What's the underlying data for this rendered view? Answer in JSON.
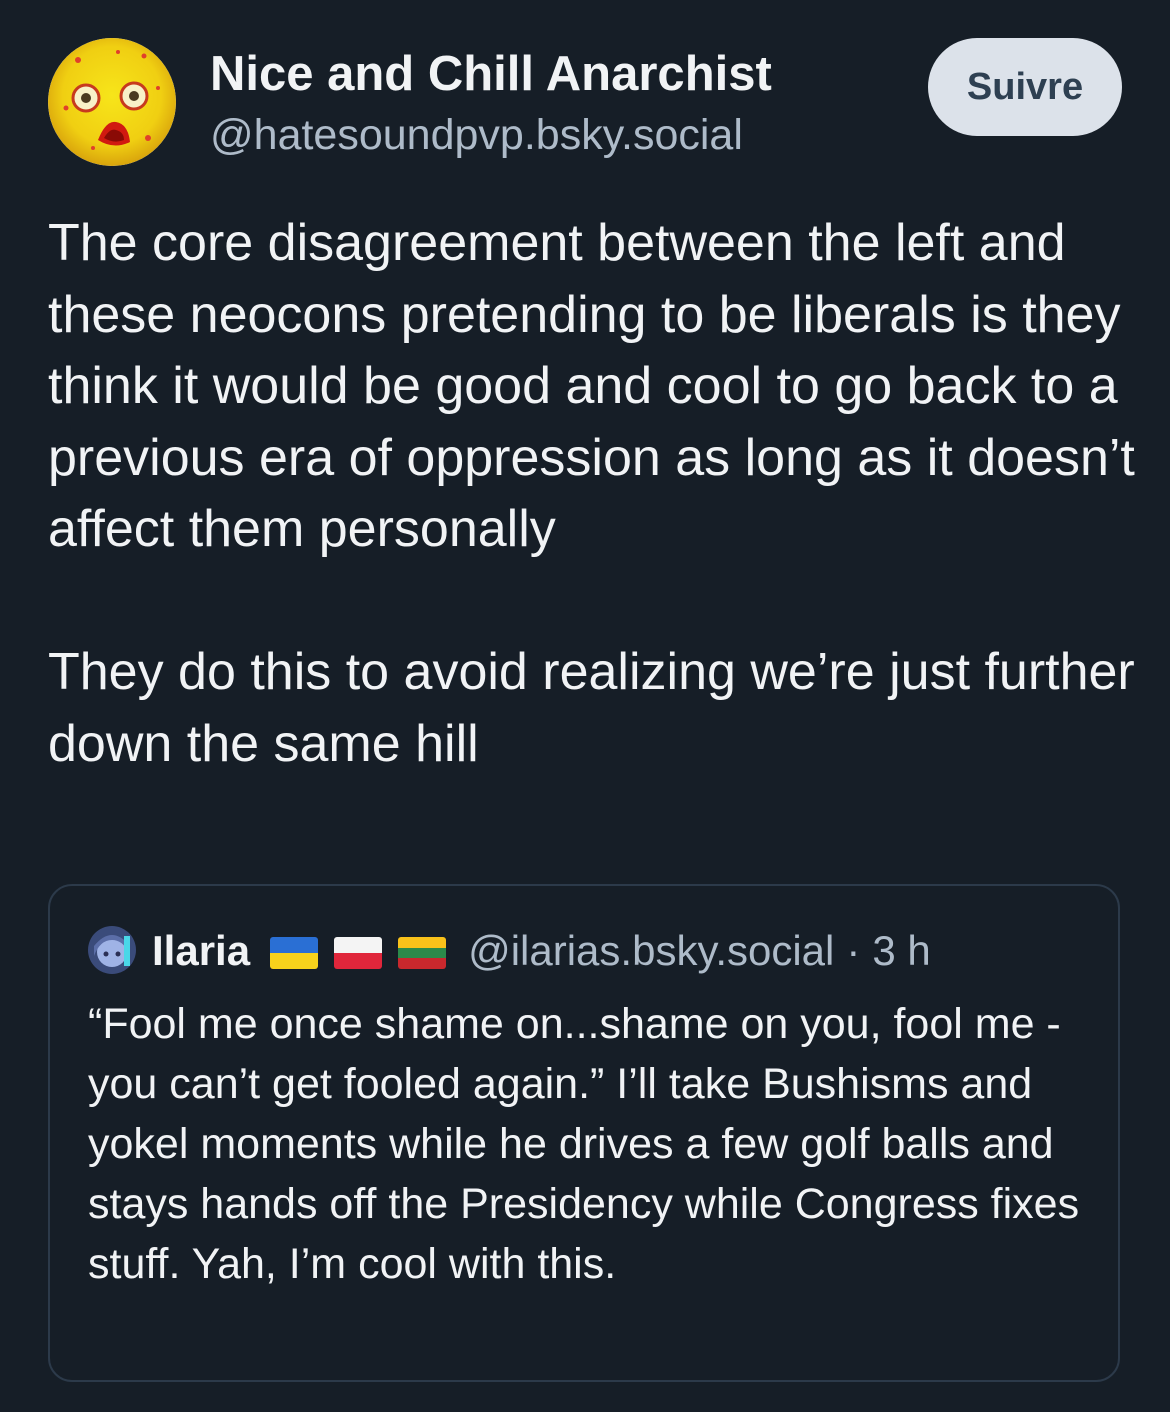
{
  "post": {
    "author": {
      "name": "Nice and Chill Anarchist",
      "handle": "@hatesoundpvp.bsky.social",
      "avatar_icon": "yellow-scream-face-avatar"
    },
    "follow_label": "Suivre",
    "text_paragraphs": [
      "The core disagreement between the left and these neocons pretending to be liberals is they think it would be good and cool to go back to a previous era of oppression as long as it doesn’t affect them personally",
      "They do this to avoid realizing we’re just further down the same hill"
    ]
  },
  "quote": {
    "author": {
      "name": "Ilaria",
      "handle": "@ilarias.bsky.social",
      "avatar_icon": "anime-avatar",
      "flags": [
        "ukraine-flag",
        "poland-flag",
        "lithuania-flag"
      ]
    },
    "separator": "·",
    "time": "3 h",
    "text": "“Fool me once shame on...shame on you, fool me - you can’t get fooled again.” I’ll take Bushisms and yokel moments while he drives a few golf balls and stays hands off the Presidency while Congress fixes stuff. Yah, I’m cool with this."
  },
  "colors": {
    "background": "#161e27",
    "text_primary": "#f1f3f5",
    "text_secondary": "#aebbc9",
    "button_bg": "#dce2ea",
    "button_text": "#2e4052",
    "quote_border": "#2c3a4a"
  }
}
